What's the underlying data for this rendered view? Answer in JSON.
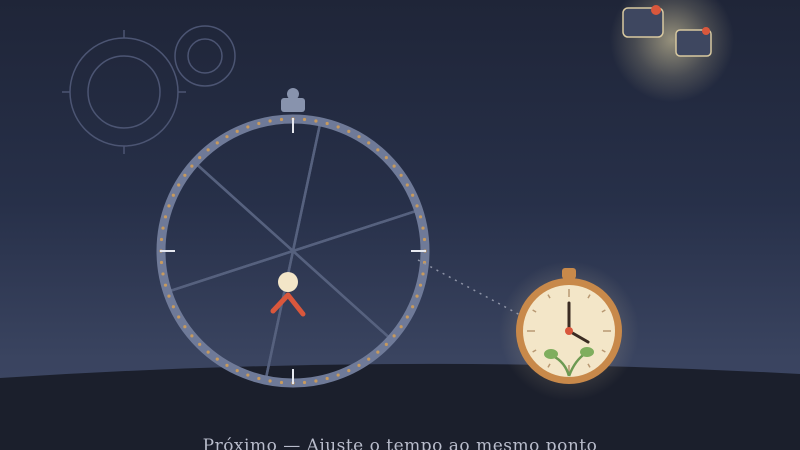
{
  "caption": "Próximo — Ajuste o tempo ao mesmo ponto",
  "colors": {
    "sky_top": "#1f2538",
    "sky_bottom": "#3f4866",
    "ground": "#1b1f2c",
    "wheel_rim": "#6f7a98",
    "rim_studs": "#c79a5e",
    "spoke": "#56617e",
    "pocket_watch_case": "#c8894a",
    "pocket_watch_face": "#f3e6c8",
    "clock_hand": "#3a2b22",
    "second_hand": "#d9573c",
    "figure_head": "#f3e6c8",
    "figure_body": "#d9573c",
    "glow": "#f5e6b0",
    "gear_outline": "#4c5573"
  },
  "icons": {
    "gears": "gear-icon",
    "wheel_top": "seat-icon",
    "pocket_watch": "pocket-watch-icon",
    "ui_cards": "card-icon"
  },
  "watch_time": {
    "hour": 4,
    "minute": 0
  }
}
